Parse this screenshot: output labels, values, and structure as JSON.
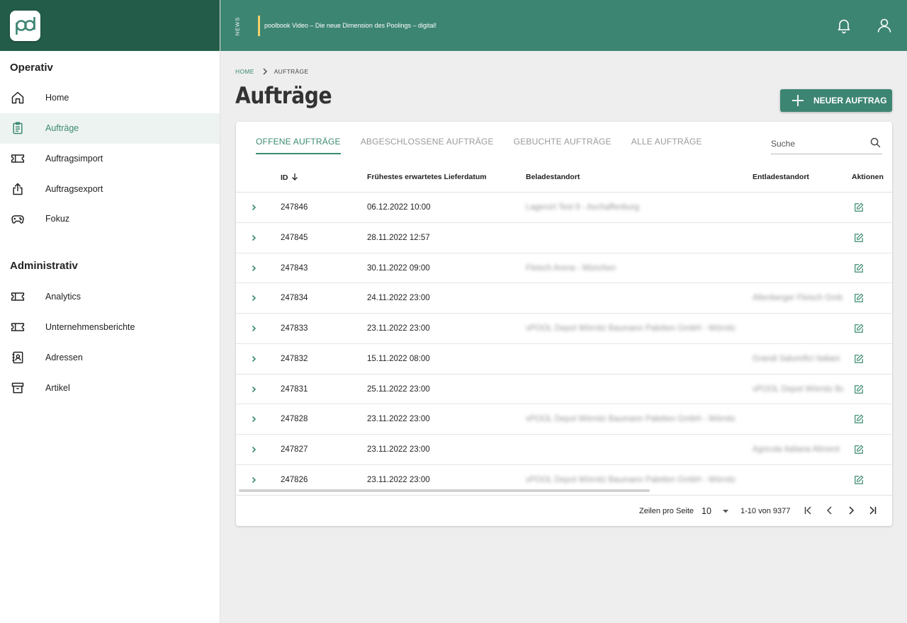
{
  "app": {
    "logo_text": "pb"
  },
  "header": {
    "news_tag": "NEWS",
    "news_text": "poolbook Video – Die neue Dimension des Poolings – digital!",
    "bell_icon": "bell-icon",
    "user_icon": "user-icon"
  },
  "sidebar": {
    "section1_title": "Operativ",
    "section1_items": [
      {
        "label": "Home",
        "icon": "home-icon"
      },
      {
        "label": "Aufträge",
        "icon": "clipboard-icon"
      },
      {
        "label": "Auftragsimport",
        "icon": "ticket-icon"
      },
      {
        "label": "Auftragsexport",
        "icon": "export-icon"
      },
      {
        "label": "Fokuz",
        "icon": "gamepad-icon"
      }
    ],
    "section2_title": "Administrativ",
    "section2_items": [
      {
        "label": "Analytics",
        "icon": "ticket-icon"
      },
      {
        "label": "Unternehmensberichte",
        "icon": "ticket-icon"
      },
      {
        "label": "Adressen",
        "icon": "address-book-icon"
      },
      {
        "label": "Artikel",
        "icon": "archive-icon"
      }
    ]
  },
  "breadcrumb": {
    "home": "HOME",
    "current": "AUFTRÄGE"
  },
  "page": {
    "title": "Aufträge",
    "new_button": "NEUER AUFTRAG"
  },
  "tabs": [
    {
      "label": "OFFENE AUFTRÄGE",
      "active": true
    },
    {
      "label": "ABGESCHLOSSENE AUFTRÄGE",
      "active": false
    },
    {
      "label": "GEBUCHTE AUFTRÄGE",
      "active": false
    },
    {
      "label": "ALLE AUFTRÄGE",
      "active": false
    }
  ],
  "search": {
    "placeholder": "Suche"
  },
  "table": {
    "columns": {
      "id": "ID",
      "date": "Frühestes erwartetes Lieferdatum",
      "load": "Beladestandort",
      "unload": "Entladestandort",
      "actions": "Aktionen"
    },
    "rows": [
      {
        "id": "247846",
        "date": "06.12.2022 10:00",
        "load": "Lagerort Test 9 - Aschaffenburg",
        "unload": ""
      },
      {
        "id": "247845",
        "date": "28.11.2022 12:57",
        "load": "",
        "unload": ""
      },
      {
        "id": "247843",
        "date": "30.11.2022 09:00",
        "load": "Fleisch Arena - München",
        "unload": ""
      },
      {
        "id": "247834",
        "date": "24.11.2022 23:00",
        "load": "",
        "unload": "Altenberger Fleisch GmbH"
      },
      {
        "id": "247833",
        "date": "23.11.2022 23:00",
        "load": "vPOOL Depot Wörnitz Baumann Paletten GmbH - Wörnitz",
        "unload": ""
      },
      {
        "id": "247832",
        "date": "15.11.2022 08:00",
        "load": "",
        "unload": "Grandi Salumifici Italiani"
      },
      {
        "id": "247831",
        "date": "25.11.2022 23:00",
        "load": "",
        "unload": "vPOOL Depot Wörnitz Ba"
      },
      {
        "id": "247828",
        "date": "23.11.2022 23:00",
        "load": "vPOOL Depot Wörnitz Baumann Paletten GmbH - Wörnitz",
        "unload": ""
      },
      {
        "id": "247827",
        "date": "23.11.2022 23:00",
        "load": "",
        "unload": "Agricola Italiana Aliment"
      },
      {
        "id": "247826",
        "date": "23.11.2022 23:00",
        "load": "vPOOL Depot Wörnitz Baumann Paletten GmbH - Wörnitz",
        "unload": ""
      }
    ]
  },
  "pagination": {
    "rows_per_page_label": "Zeilen pro Seite",
    "rows_per_page": "10",
    "range": "1-10 von 9377"
  },
  "colors": {
    "brand_dark": "#235c48",
    "brand": "#3d8573",
    "accent": "#3b8a72",
    "news_bar": "#f2d16b"
  }
}
